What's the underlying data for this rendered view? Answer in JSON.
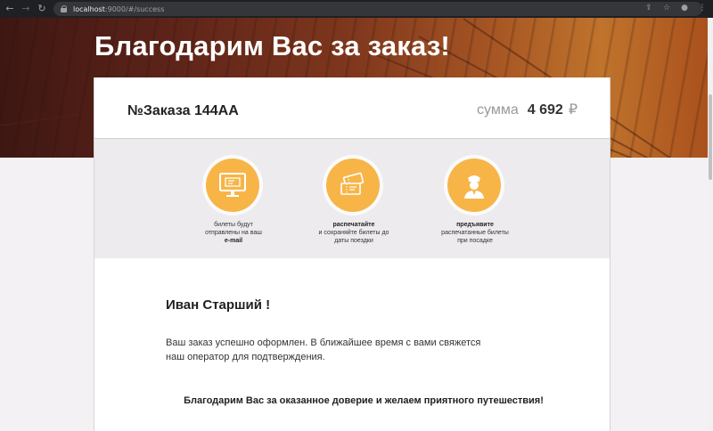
{
  "browser": {
    "url_host": "localhost",
    "url_path": ":9000/#/success"
  },
  "hero": {
    "title": "Благодарим Вас за заказ!"
  },
  "order": {
    "number_label": "№Заказа 144АА",
    "sum_label": "сумма",
    "sum_value": "4 692",
    "currency": "₽"
  },
  "steps": [
    {
      "icon": "monitor-ticket-icon",
      "line1": "билеты будут",
      "line2": "отправлены на ваш",
      "bold": "e-mail"
    },
    {
      "icon": "tickets-icon",
      "bold": "распечатайте",
      "line1": "и сохраняйте билеты до",
      "line2": "даты поездки"
    },
    {
      "icon": "conductor-icon",
      "bold": "предъявите",
      "line1": "распечатанные билеты",
      "line2": "при посадке"
    }
  ],
  "message": {
    "greeting": "Иван Старший !",
    "body": "Ваш заказ успешно оформлен. В ближайшее время с вами свяжется наш оператор для подтверждения.",
    "thanks": "Благодарим Вас за оказанное доверие и желаем приятного путешествия!"
  },
  "colors": {
    "accent": "#f7b548",
    "hero_dark": "#3c1612",
    "hero_light": "#e18c32"
  }
}
